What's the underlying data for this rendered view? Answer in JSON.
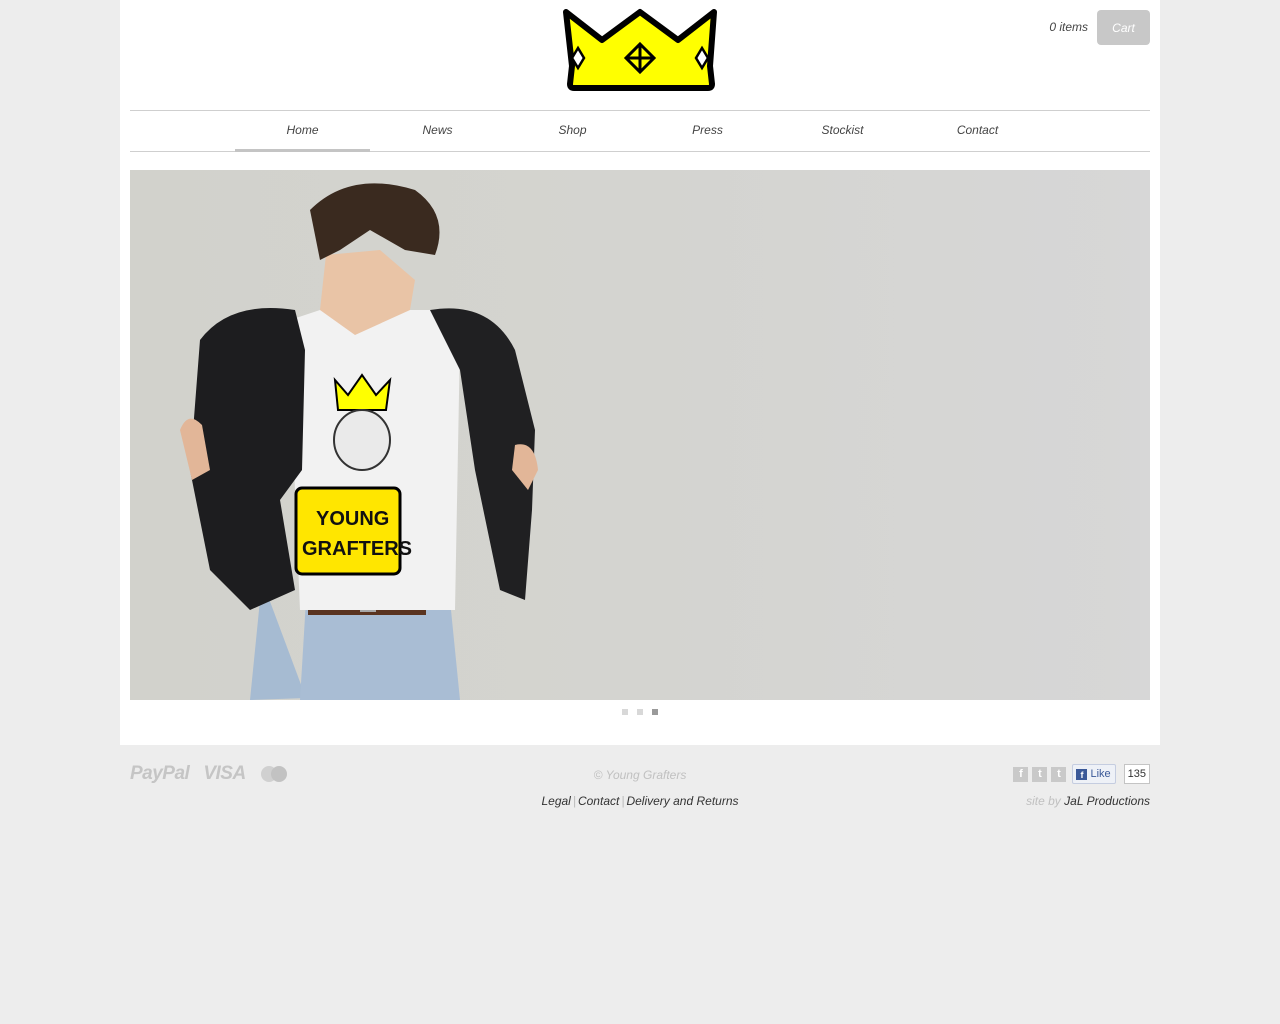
{
  "header": {
    "logo": "crown-logo",
    "cart_count": "0 items",
    "cart_label": "Cart"
  },
  "nav": {
    "items": [
      {
        "label": "Home",
        "active": true
      },
      {
        "label": "News"
      },
      {
        "label": "Shop"
      },
      {
        "label": "Press"
      },
      {
        "label": "Stockist"
      },
      {
        "label": "Contact"
      }
    ]
  },
  "slider": {
    "image": "model-wearing-young-grafters-tshirt",
    "shirt_text": "YOUNG GRAFTERS",
    "slide_count": 3,
    "active_slide": 3
  },
  "footer": {
    "payment": [
      "PayPal",
      "VISA"
    ],
    "copyright": "© Young Grafters",
    "links": [
      "Legal",
      "Contact",
      "Delivery and Returns"
    ],
    "social_icons": [
      "facebook-icon",
      "twitter-icon",
      "tumblr-icon"
    ],
    "like_label": "Like",
    "like_count": "135",
    "site_by_prefix": "site by",
    "site_by_link": "JaL Productions"
  },
  "colors": {
    "background": "#ededed",
    "crown_yellow": "#ffff00",
    "button_gray": "#c8c8c8"
  }
}
